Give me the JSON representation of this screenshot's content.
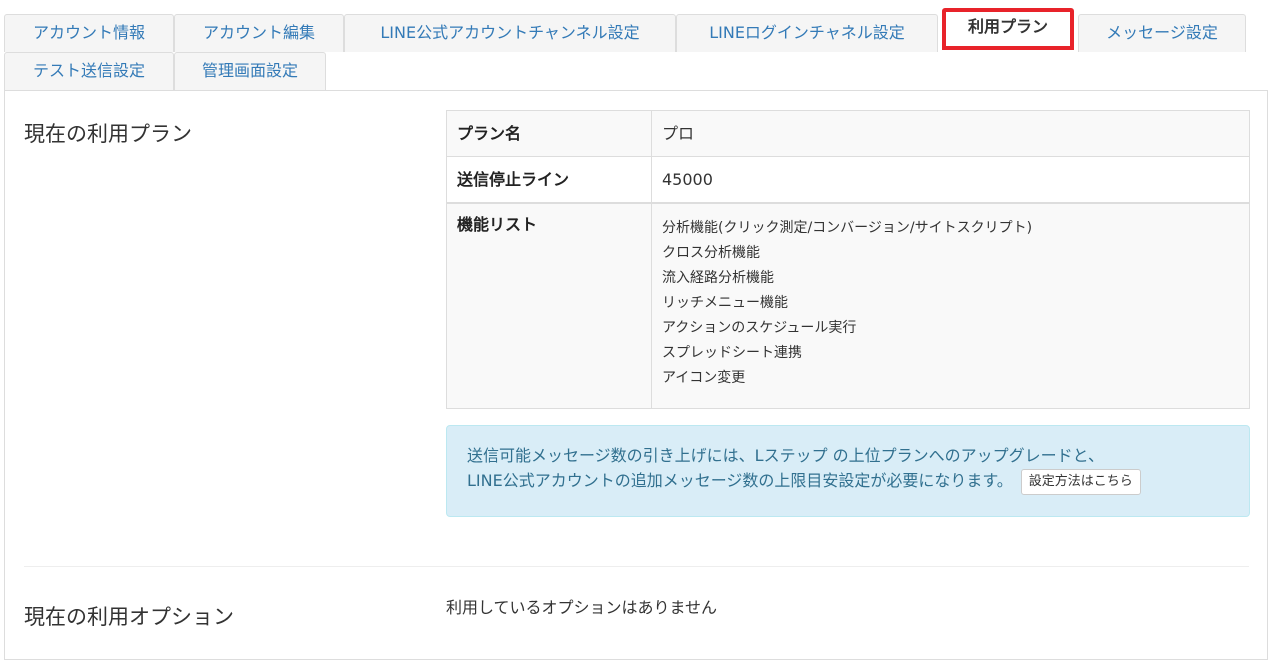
{
  "tabs": [
    {
      "label": "アカウント情報",
      "active": false
    },
    {
      "label": "アカウント編集",
      "active": false
    },
    {
      "label": "LINE公式アカウントチャンネル設定",
      "active": false
    },
    {
      "label": "LINEログインチャネル設定",
      "active": false
    },
    {
      "label": "利用プラン",
      "active": true
    },
    {
      "label": "メッセージ設定",
      "active": false
    },
    {
      "label": "テスト送信設定",
      "active": false
    },
    {
      "label": "管理画面設定",
      "active": false
    }
  ],
  "current_plan": {
    "title": "現在の利用プラン",
    "plan_name_label": "プラン名",
    "plan_name_value": "プロ",
    "stop_line_label": "送信停止ライン",
    "stop_line_value": "45000",
    "features_label": "機能リスト",
    "features": [
      "分析機能(クリック測定/コンバージョン/サイトスクリプト)",
      "クロス分析機能",
      "流入経路分析機能",
      "リッチメニュー機能",
      "アクションのスケジュール実行",
      "スプレッドシート連携",
      "アイコン変更"
    ]
  },
  "notice": {
    "line1": "送信可能メッセージ数の引き上げには、Lステップ の上位プランへのアップグレードと、",
    "line2": "LINE公式アカウントの追加メッセージ数の上限目安設定が必要になります。",
    "button_label": "設定方法はこちら"
  },
  "current_options": {
    "title": "現在の利用オプション",
    "text": "利用しているオプションはありません"
  },
  "colors": {
    "active_tab_border": "#e8232a",
    "tab_link": "#337ab7",
    "notice_bg": "#d9edf7",
    "notice_text": "#31708f"
  }
}
